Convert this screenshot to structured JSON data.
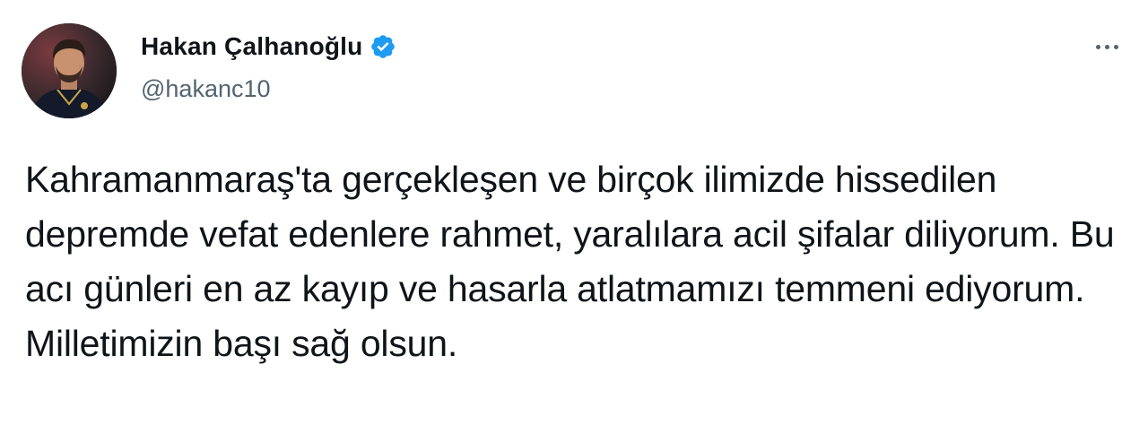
{
  "author": {
    "display_name": "Hakan Çalhanoğlu",
    "handle": "@hakanc10",
    "verified": true,
    "avatar_icon": "profile-photo"
  },
  "tweet": {
    "text": "Kahramanmaraş'ta gerçekleşen ve birçok ilimizde hissedilen depremde vefat edenlere rahmet, yaralılara acil şifalar diliyorum. Bu acı günleri en az kayıp ve hasarla atlatmamızı temmeni ediyorum. Milletimizin başı sağ olsun."
  },
  "icons": {
    "more": "more-options-icon",
    "verified": "verified-badge-icon"
  },
  "colors": {
    "text_primary": "#0f1419",
    "text_secondary": "#536471",
    "verified_blue": "#1d9bf0",
    "background": "#ffffff"
  }
}
